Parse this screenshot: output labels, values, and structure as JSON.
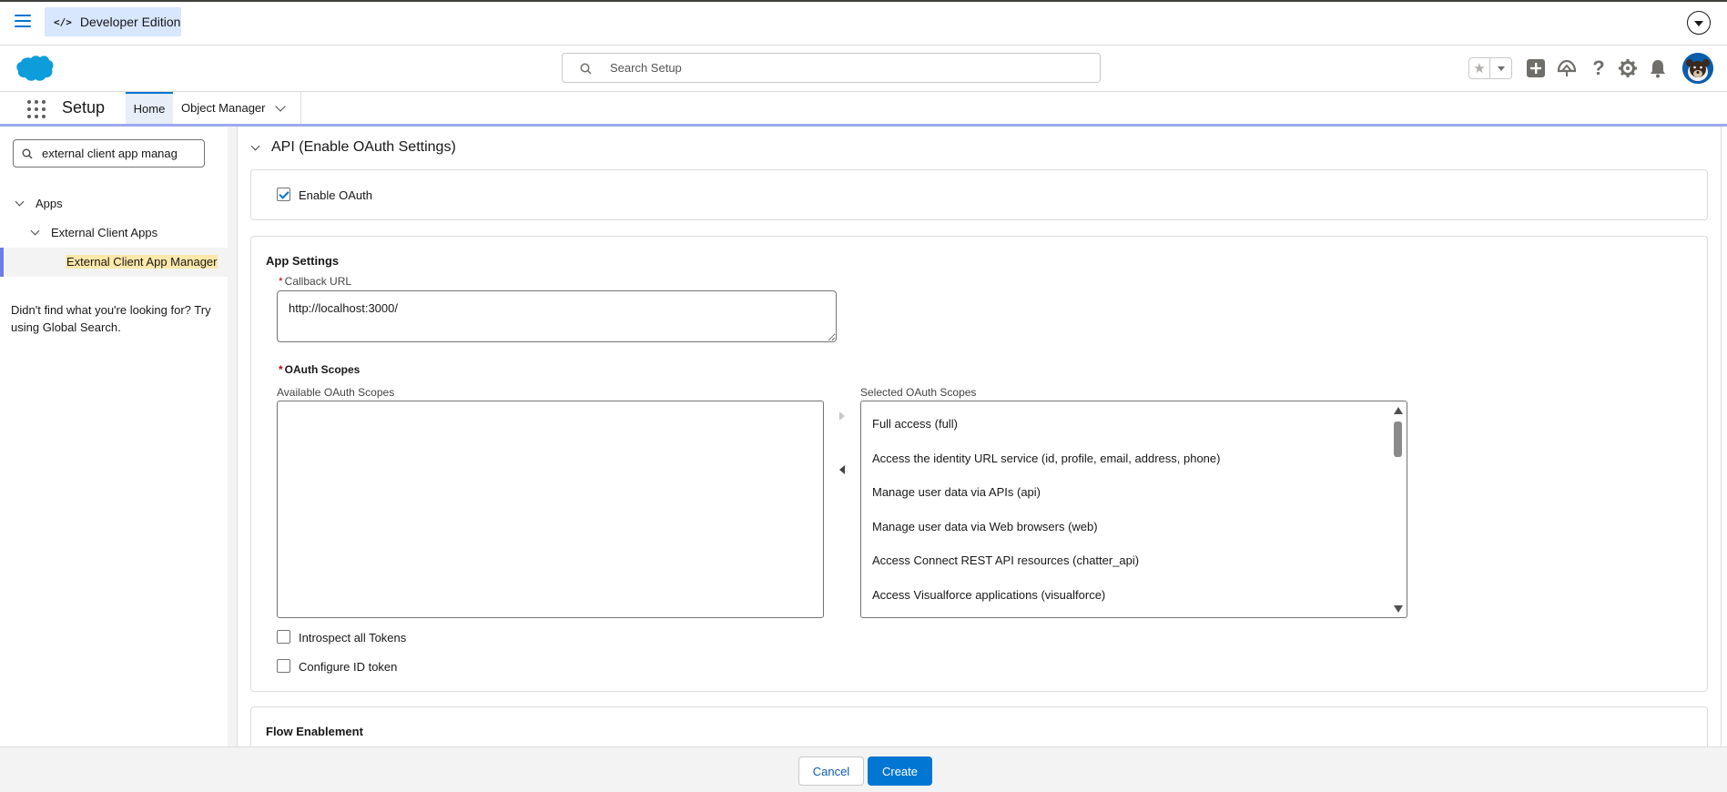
{
  "topbar": {
    "edition_label": "Developer Edition",
    "edition_icon": "</>"
  },
  "header": {
    "search_placeholder": "Search Setup",
    "icons": [
      "favorites-star-icon",
      "add-icon",
      "trailhead-icon",
      "help-icon",
      "setup-gear-icon",
      "notifications-bell-icon",
      "avatar"
    ]
  },
  "appnav": {
    "app_name": "Setup",
    "tabs": [
      {
        "label": "Home",
        "active": true
      },
      {
        "label": "Object Manager",
        "active": false
      }
    ]
  },
  "sidebar": {
    "search_value": "external client app manag",
    "tree": [
      {
        "label": "Apps",
        "level": 0,
        "expanded": true
      },
      {
        "label": "External Client Apps",
        "level": 1,
        "expanded": true
      },
      {
        "label": "External Client App Manager",
        "level": 2,
        "selected": true
      }
    ],
    "help_text": "Didn't find what you're looking for? Try using Global Search."
  },
  "main": {
    "section_title": "API (Enable OAuth Settings)",
    "enable_oauth": {
      "label": "Enable OAuth",
      "checked": true
    },
    "app_settings": {
      "title": "App Settings",
      "callback_url_label": "Callback URL",
      "callback_url_value": "http://localhost:3000/",
      "oauth_scopes_label": "OAuth Scopes",
      "available_label": "Available OAuth Scopes",
      "selected_label": "Selected OAuth Scopes",
      "available_scopes": [],
      "selected_scopes": [
        "Full access (full)",
        "Access the identity URL service (id, profile, email, address, phone)",
        "Manage user data via APIs (api)",
        "Manage user data via Web browsers (web)",
        "Access Connect REST API resources (chatter_api)",
        "Access Visualforce applications (visualforce)"
      ],
      "introspect_tokens": {
        "label": "Introspect all Tokens",
        "checked": false
      },
      "configure_id_token": {
        "label": "Configure ID token",
        "checked": false
      }
    },
    "flow_enablement_title": "Flow Enablement"
  },
  "footer": {
    "cancel_label": "Cancel",
    "create_label": "Create"
  },
  "colors": {
    "brand_blue": "#0176d3",
    "selection_highlight": "#fce8a8",
    "edition_badge_bg": "#d8e6fe"
  }
}
